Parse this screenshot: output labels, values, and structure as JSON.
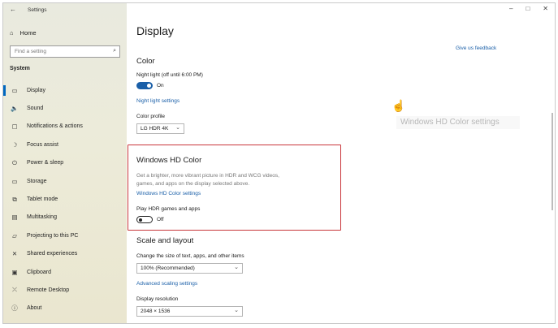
{
  "window": {
    "title": "Settings",
    "controls": [
      "–",
      "□",
      "✕"
    ]
  },
  "sidebar": {
    "home": "Home",
    "search_placeholder": "Find a setting",
    "section": "System",
    "items": [
      {
        "label": "Display",
        "icon": "monitor-icon",
        "glyph": "▭",
        "active": true
      },
      {
        "label": "Sound",
        "icon": "speaker-icon",
        "glyph": "🔈"
      },
      {
        "label": "Notifications & actions",
        "icon": "notification-icon",
        "glyph": "▢"
      },
      {
        "label": "Focus assist",
        "icon": "moon-icon",
        "glyph": "☽"
      },
      {
        "label": "Power & sleep",
        "icon": "power-icon",
        "glyph": "⏻"
      },
      {
        "label": "Storage",
        "icon": "storage-icon",
        "glyph": "▭"
      },
      {
        "label": "Tablet mode",
        "icon": "tablet-icon",
        "glyph": "⧉"
      },
      {
        "label": "Multitasking",
        "icon": "multitasking-icon",
        "glyph": "▤"
      },
      {
        "label": "Projecting to this PC",
        "icon": "projector-icon",
        "glyph": "▱"
      },
      {
        "label": "Shared experiences",
        "icon": "shared-icon",
        "glyph": "✕"
      },
      {
        "label": "Clipboard",
        "icon": "clipboard-icon",
        "glyph": "▣"
      },
      {
        "label": "Remote Desktop",
        "icon": "remote-desktop-icon",
        "glyph": "⤫"
      },
      {
        "label": "About",
        "icon": "info-icon",
        "glyph": "ⓘ"
      }
    ]
  },
  "main": {
    "title": "Display",
    "feedback_link": "Give us feedback",
    "color": {
      "heading": "Color",
      "night_light_label": "Night light (off until 6:00 PM)",
      "night_light_state": "On",
      "night_light_settings": "Night light settings",
      "profile_label": "Color profile",
      "profile_value": "LG HDR 4K"
    },
    "hd_color": {
      "heading": "Windows HD Color",
      "description_line1": "Get a brighter, more vibrant picture in HDR and WCG videos,",
      "description_line2": "games, and apps on the display selected above.",
      "settings_link": "Windows HD Color settings",
      "hdr_label": "Play HDR games and apps",
      "hdr_state": "Off"
    },
    "scale": {
      "heading": "Scale and layout",
      "size_label": "Change the size of text, apps, and other items",
      "size_value": "100% (Recommended)",
      "advanced_link": "Advanced scaling settings",
      "resolution_label": "Display resolution",
      "resolution_value": "2048 × 1536"
    },
    "tooltip": "Windows HD Color settings"
  },
  "colors": {
    "accent": "#1a5fa8",
    "highlight_box": "#c8353a"
  }
}
